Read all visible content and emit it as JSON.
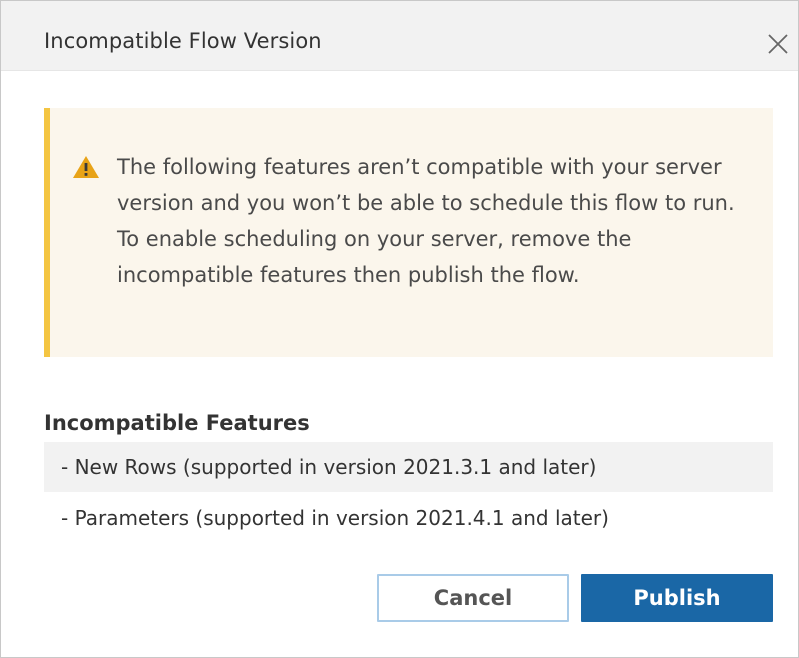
{
  "dialog": {
    "title": "Incompatible Flow Version",
    "close_icon": "close-icon"
  },
  "warning": {
    "icon": "warning-triangle-icon",
    "message": "The following features aren’t compatible with your server version and you won’t be able to schedule this flow to run. To enable scheduling on your server, remove the incompatible features then publish the flow.",
    "background_color": "#fbf6ec",
    "accent_color": "#f4c542"
  },
  "features": {
    "heading": "Incompatible Features",
    "items": [
      "- New Rows (supported in version 2021.3.1 and later)",
      "- Parameters (supported in version 2021.4.1 and later)"
    ]
  },
  "buttons": {
    "cancel_label": "Cancel",
    "publish_label": "Publish",
    "primary_color": "#1a67a6"
  }
}
